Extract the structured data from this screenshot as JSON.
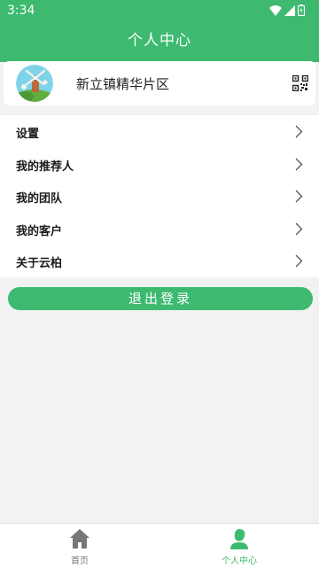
{
  "status_bar": {
    "time": "3:34"
  },
  "header": {
    "title": "个人中心"
  },
  "profile": {
    "name": "新立镇精华片区"
  },
  "menu": {
    "items": [
      {
        "label": "设置"
      },
      {
        "label": "我的推荐人"
      },
      {
        "label": "我的团队"
      },
      {
        "label": "我的客户"
      },
      {
        "label": "关于云柏"
      }
    ]
  },
  "logout": {
    "label": "退出登录"
  },
  "tabbar": {
    "tabs": [
      {
        "label": "首页",
        "icon": "home-icon",
        "active": false
      },
      {
        "label": "个人中心",
        "icon": "person-icon",
        "active": true
      }
    ]
  },
  "colors": {
    "accent": "#3dba6f",
    "inactive": "#777777",
    "background": "#f2f2f2"
  }
}
